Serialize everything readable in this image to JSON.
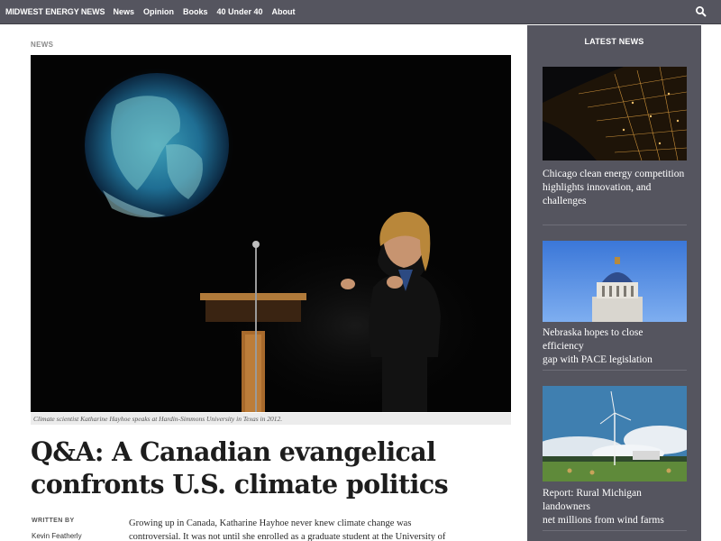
{
  "nav": {
    "brand": "MIDWEST ENERGY NEWS",
    "links": [
      "News",
      "Opinion",
      "Books",
      "40 Under 40",
      "About"
    ],
    "search_icon": "search-icon"
  },
  "article": {
    "section": "NEWS",
    "caption": "Climate scientist Katharine Hayhoe speaks at Hardin-Simmons University in Texas in 2012.",
    "headline_line1": "Q&A: A Canadian evangelical",
    "headline_line2": "confronts U.S. climate politics",
    "written_by_label": "WRITTEN BY",
    "author": "Kevin Featherly",
    "body_line1": "Growing up in Canada, Katharine Hayhoe never knew climate change was",
    "body_line2": "controversial. It was not until she enrolled as a graduate student at the University of"
  },
  "sidebar": {
    "title": "LATEST NEWS",
    "items": [
      {
        "line1": "Chicago clean energy competition",
        "line2": "highlights innovation, and",
        "line3": "challenges"
      },
      {
        "line1": "Nebraska hopes to close efficiency",
        "line2": "gap with PACE legislation",
        "line3": ""
      },
      {
        "line1": "Report: Rural Michigan landowners",
        "line2": "net millions from wind farms",
        "line3": ""
      }
    ]
  },
  "colors": {
    "nav_bg": "#55555f",
    "rail_bg": "#55555f",
    "headline": "#1d1d1d"
  }
}
